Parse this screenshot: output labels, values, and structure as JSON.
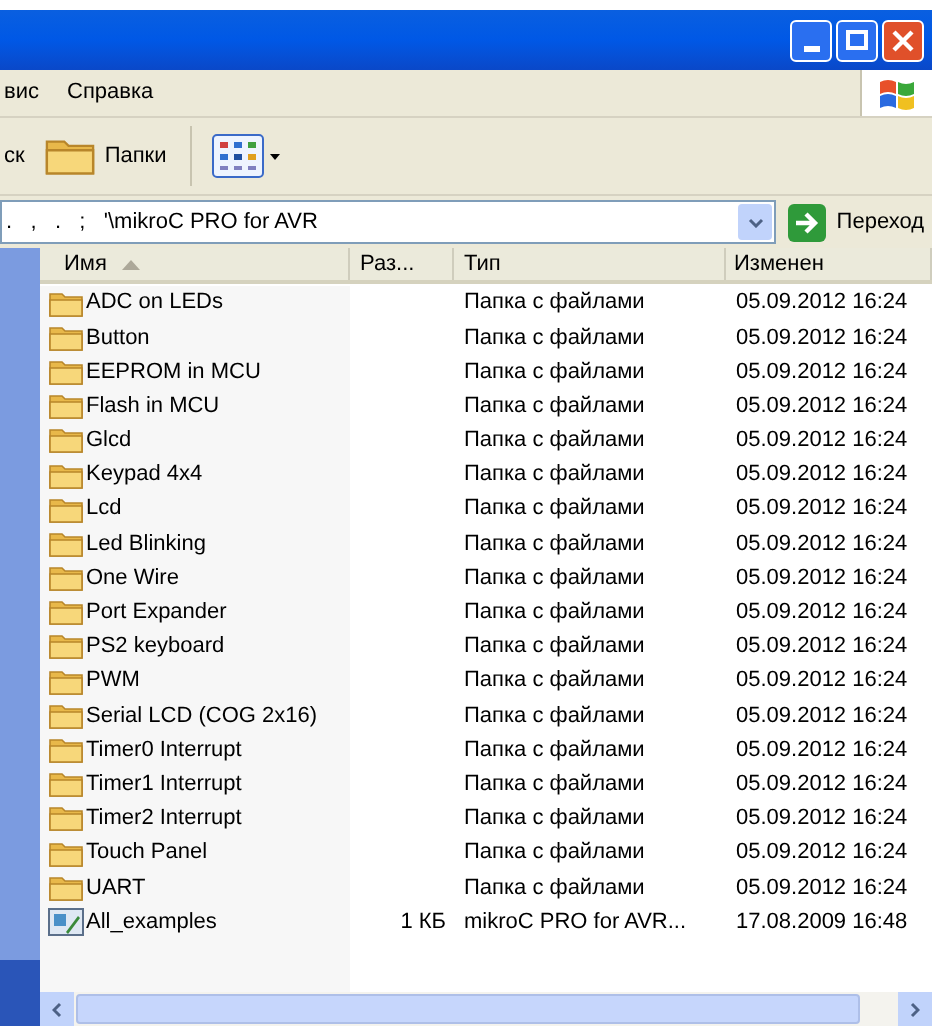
{
  "menu": [
    {
      "label": "вис"
    },
    {
      "label": "Справка"
    }
  ],
  "toolbar": [
    {
      "kind": "button",
      "label": "ск"
    },
    {
      "kind": "folders",
      "label": "Папки"
    },
    {
      "kind": "views"
    }
  ],
  "address": {
    "value": ".   ,   .   ;   '\\mikroC PRO for AVR",
    "go_label": "Переход"
  },
  "columns": [
    {
      "label": "Имя",
      "sorted": true
    },
    {
      "label": "Раз...",
      "sorted": false
    },
    {
      "label": "Тип",
      "sorted": false
    },
    {
      "label": "Изменен",
      "sorted": false
    }
  ],
  "rows": [
    {
      "kind": "folder",
      "name": "ADC on LEDs",
      "size": "",
      "type": "Папка с файлами",
      "modified": "05.09.2012 16:24"
    },
    {
      "kind": "folder",
      "name": "Button",
      "size": "",
      "type": "Папка с файлами",
      "modified": "05.09.2012 16:24"
    },
    {
      "kind": "folder",
      "name": "EEPROM in MCU",
      "size": "",
      "type": "Папка с файлами",
      "modified": "05.09.2012 16:24"
    },
    {
      "kind": "folder",
      "name": "Flash in MCU",
      "size": "",
      "type": "Папка с файлами",
      "modified": "05.09.2012 16:24"
    },
    {
      "kind": "folder",
      "name": "Glcd",
      "size": "",
      "type": "Папка с файлами",
      "modified": "05.09.2012 16:24"
    },
    {
      "kind": "folder",
      "name": "Keypad 4x4",
      "size": "",
      "type": "Папка с файлами",
      "modified": "05.09.2012 16:24"
    },
    {
      "kind": "folder",
      "name": "Lcd",
      "size": "",
      "type": "Папка с файлами",
      "modified": "05.09.2012 16:24"
    },
    {
      "kind": "folder",
      "name": "Led Blinking",
      "size": "",
      "type": "Папка с файлами",
      "modified": "05.09.2012 16:24"
    },
    {
      "kind": "folder",
      "name": "One Wire",
      "size": "",
      "type": "Папка с файлами",
      "modified": "05.09.2012 16:24"
    },
    {
      "kind": "folder",
      "name": "Port Expander",
      "size": "",
      "type": "Папка с файлами",
      "modified": "05.09.2012 16:24"
    },
    {
      "kind": "folder",
      "name": "PS2 keyboard",
      "size": "",
      "type": "Папка с файлами",
      "modified": "05.09.2012 16:24"
    },
    {
      "kind": "folder",
      "name": "PWM",
      "size": "",
      "type": "Папка с файлами",
      "modified": "05.09.2012 16:24"
    },
    {
      "kind": "folder",
      "name": "Serial LCD (COG 2x16)",
      "size": "",
      "type": "Папка с файлами",
      "modified": "05.09.2012 16:24"
    },
    {
      "kind": "folder",
      "name": "Timer0 Interrupt",
      "size": "",
      "type": "Папка с файлами",
      "modified": "05.09.2012 16:24"
    },
    {
      "kind": "folder",
      "name": "Timer1 Interrupt",
      "size": "",
      "type": "Папка с файлами",
      "modified": "05.09.2012 16:24"
    },
    {
      "kind": "folder",
      "name": "Timer2 Interrupt",
      "size": "",
      "type": "Папка с файлами",
      "modified": "05.09.2012 16:24"
    },
    {
      "kind": "folder",
      "name": "Touch Panel",
      "size": "",
      "type": "Папка с файлами",
      "modified": "05.09.2012 16:24"
    },
    {
      "kind": "folder",
      "name": "UART",
      "size": "",
      "type": "Папка с файлами",
      "modified": "05.09.2012 16:24"
    },
    {
      "kind": "project",
      "name": "All_examples",
      "size": "1 КБ",
      "type": "mikroC PRO for AVR...",
      "modified": "17.08.2009 16:48"
    }
  ]
}
